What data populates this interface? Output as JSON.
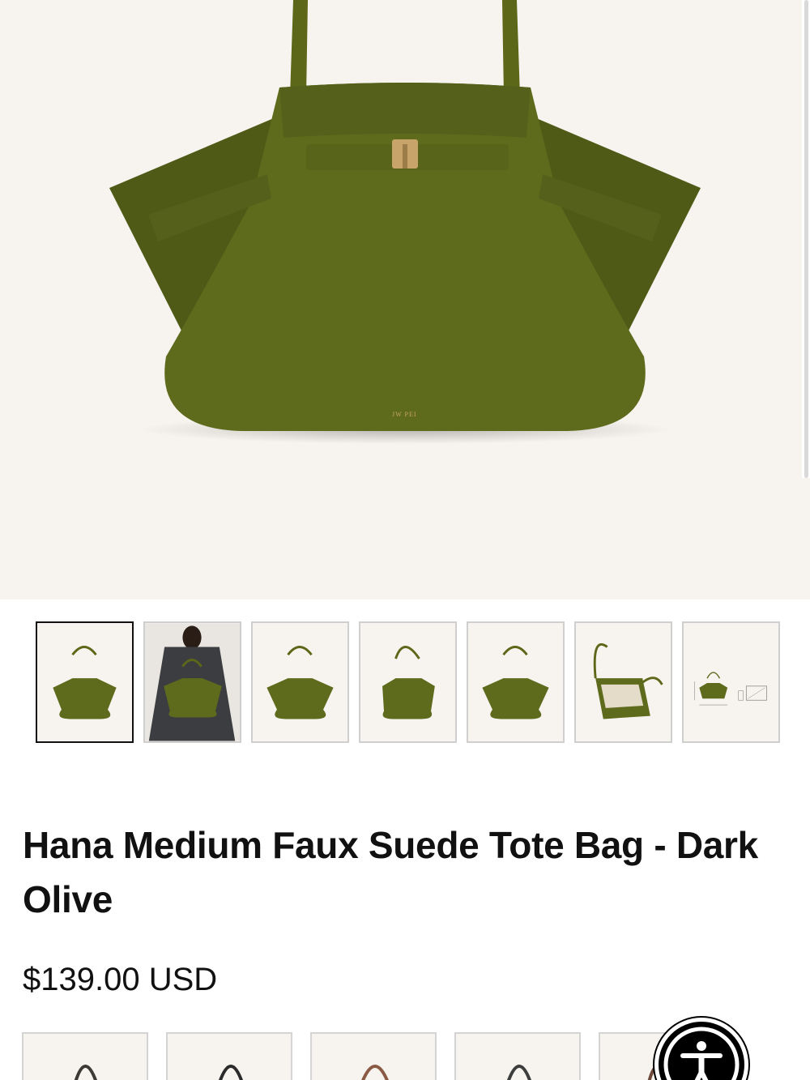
{
  "product": {
    "title": "Hana Medium Faux Suede Tote Bag - Dark Olive",
    "price": "$139.00 USD",
    "brand_mark": "JW PEI"
  },
  "gallery": {
    "thumbnails": [
      {
        "name": "thumb-front-view",
        "selected": true
      },
      {
        "name": "thumb-model-view",
        "selected": false
      },
      {
        "name": "thumb-front-view-2",
        "selected": false
      },
      {
        "name": "thumb-angle-view",
        "selected": false
      },
      {
        "name": "thumb-back-view",
        "selected": false
      },
      {
        "name": "thumb-interior-view",
        "selected": false
      },
      {
        "name": "thumb-dimensions-view",
        "selected": false
      }
    ]
  },
  "swatches": {
    "colors": [
      "#3b3a35",
      "#2b2b2b",
      "#8a5a44",
      "#3d3d3d",
      "#6e4a3a"
    ]
  },
  "accessibility": {
    "icon": "accessibility-person-icon"
  },
  "colors": {
    "bag_olive": "#5f6b1c",
    "bag_olive_dark": "#4e5915",
    "background": "#f7f4ef",
    "text": "#111111",
    "hardware_gold": "#c8a46a"
  }
}
